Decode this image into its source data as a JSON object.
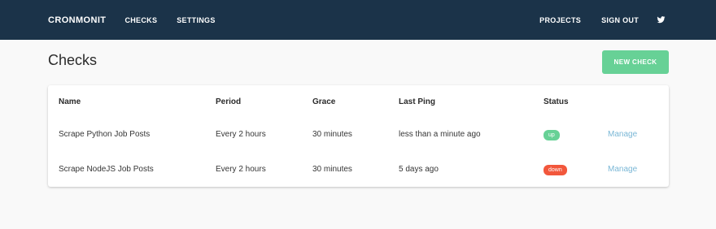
{
  "nav": {
    "brand": "CRONMONIT",
    "links": [
      "CHECKS",
      "SETTINGS"
    ],
    "right_links": [
      "PROJECTS",
      "SIGN OUT"
    ],
    "social_icon": "twitter-icon"
  },
  "page": {
    "title": "Checks",
    "new_check_label": "NEW CHECK"
  },
  "table": {
    "headers": [
      "Name",
      "Period",
      "Grace",
      "Last Ping",
      "Status"
    ],
    "rows": [
      {
        "name": "Scrape Python Job Posts",
        "period": "Every 2 hours",
        "grace": "30 minutes",
        "last_ping": "less than a minute ago",
        "status": "up",
        "action": "Manage"
      },
      {
        "name": "Scrape NodeJS Job Posts",
        "period": "Every 2 hours",
        "grace": "30 minutes",
        "last_ping": "5 days ago",
        "status": "down",
        "action": "Manage"
      }
    ]
  },
  "colors": {
    "navbar": "#1b3349",
    "accent_green": "#67d196",
    "status_down": "#f2573c",
    "link": "#7ab7d6"
  }
}
